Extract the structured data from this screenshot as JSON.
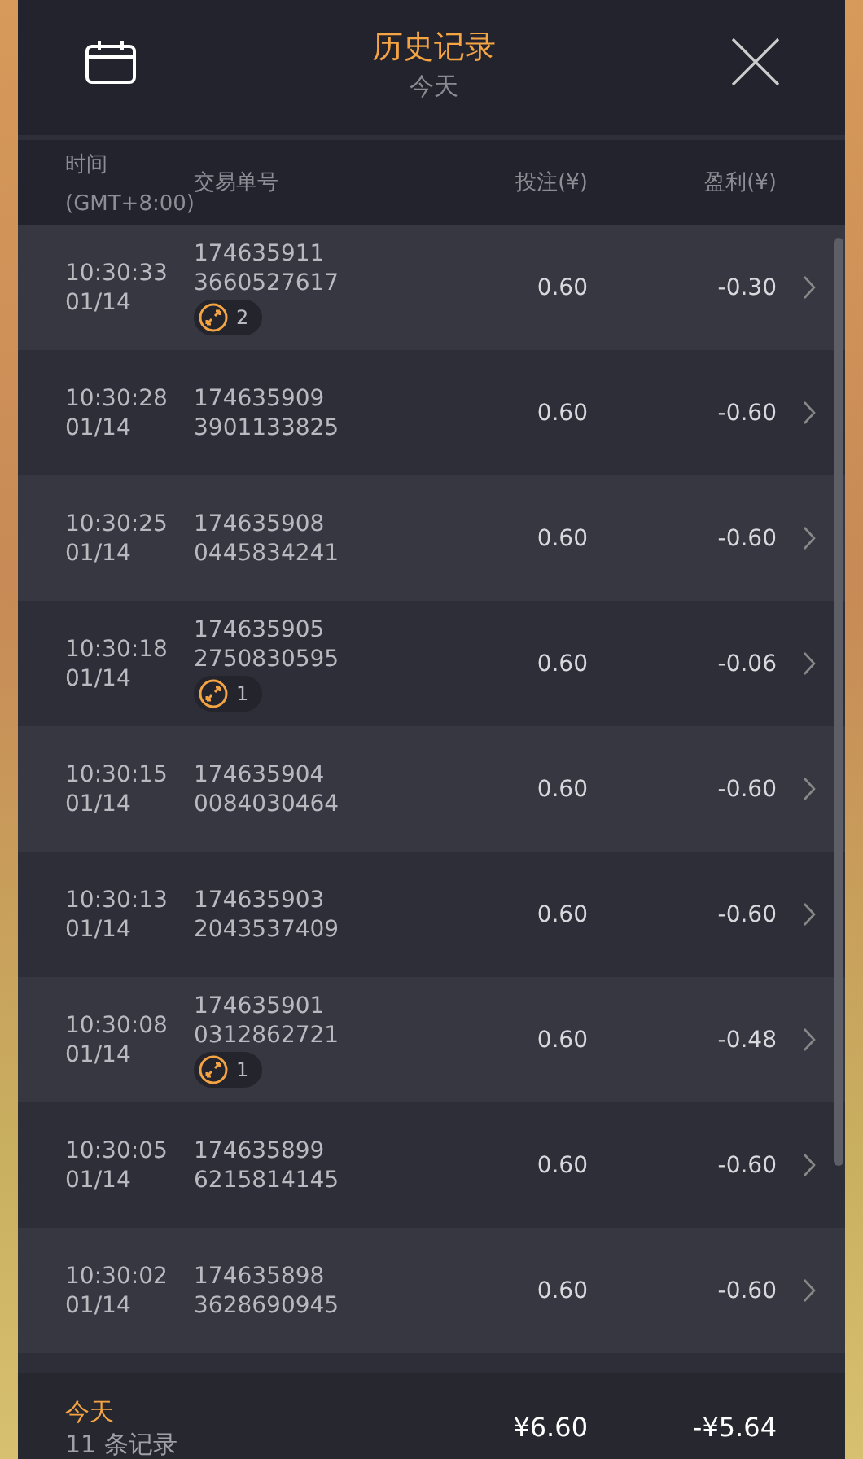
{
  "header": {
    "title": "历史记录",
    "subtitle": "今天"
  },
  "columns": {
    "time": "时间",
    "timezone": "(GMT+8:00)",
    "order": "交易单号",
    "bet": "投注(¥)",
    "profit": "盈利(¥)"
  },
  "rows": [
    {
      "time": "10:30:33",
      "date": "01/14",
      "order_1": "174635911",
      "order_2": "3660527617",
      "badge": "2",
      "bet": "0.60",
      "profit": "-0.30"
    },
    {
      "time": "10:30:28",
      "date": "01/14",
      "order_1": "174635909",
      "order_2": "3901133825",
      "bet": "0.60",
      "profit": "-0.60"
    },
    {
      "time": "10:30:25",
      "date": "01/14",
      "order_1": "174635908",
      "order_2": "0445834241",
      "bet": "0.60",
      "profit": "-0.60"
    },
    {
      "time": "10:30:18",
      "date": "01/14",
      "order_1": "174635905",
      "order_2": "2750830595",
      "badge": "1",
      "bet": "0.60",
      "profit": "-0.06"
    },
    {
      "time": "10:30:15",
      "date": "01/14",
      "order_1": "174635904",
      "order_2": "0084030464",
      "bet": "0.60",
      "profit": "-0.60"
    },
    {
      "time": "10:30:13",
      "date": "01/14",
      "order_1": "174635903",
      "order_2": "2043537409",
      "bet": "0.60",
      "profit": "-0.60"
    },
    {
      "time": "10:30:08",
      "date": "01/14",
      "order_1": "174635901",
      "order_2": "0312862721",
      "badge": "1",
      "bet": "0.60",
      "profit": "-0.48"
    },
    {
      "time": "10:30:05",
      "date": "01/14",
      "order_1": "174635899",
      "order_2": "6215814145",
      "bet": "0.60",
      "profit": "-0.60"
    },
    {
      "time": "10:30:02",
      "date": "01/14",
      "order_1": "174635898",
      "order_2": "3628690945",
      "bet": "0.60",
      "profit": "-0.60"
    }
  ],
  "footer": {
    "period": "今天",
    "count": "11 条记录",
    "total_bet": "¥6.60",
    "total_profit": "-¥5.64"
  }
}
